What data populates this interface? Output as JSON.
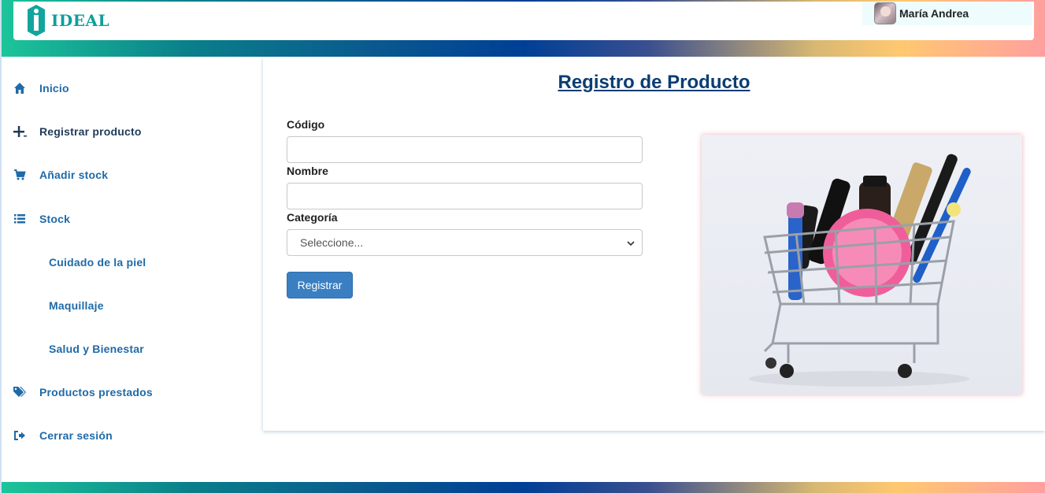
{
  "header": {
    "brand": "IDEAL",
    "user_name": "María Andrea"
  },
  "sidebar": {
    "items": [
      {
        "label": "Inicio",
        "icon": "home-icon"
      },
      {
        "label": "Registrar producto",
        "icon": "plus-icon"
      },
      {
        "label": "Añadir stock",
        "icon": "cart-icon"
      },
      {
        "label": "Stock",
        "icon": "list-icon"
      },
      {
        "label": "Cuidado de la piel",
        "icon": ""
      },
      {
        "label": "Maquillaje",
        "icon": ""
      },
      {
        "label": "Salud y Bienestar",
        "icon": ""
      },
      {
        "label": "Productos prestados",
        "icon": "tags-icon"
      },
      {
        "label": "Cerrar sesión",
        "icon": "logout-icon"
      }
    ]
  },
  "form": {
    "title": "Registro de Producto",
    "codigo_label": "Código",
    "codigo_value": "",
    "nombre_label": "Nombre",
    "nombre_value": "",
    "categoria_label": "Categoría",
    "categoria_selected": "Seleccione...",
    "submit_label": "Registrar"
  },
  "colors": {
    "accent": "#1f6aa8",
    "button": "#3a7fc1",
    "title": "#0a3d73",
    "brand": "#0f9e9a"
  }
}
